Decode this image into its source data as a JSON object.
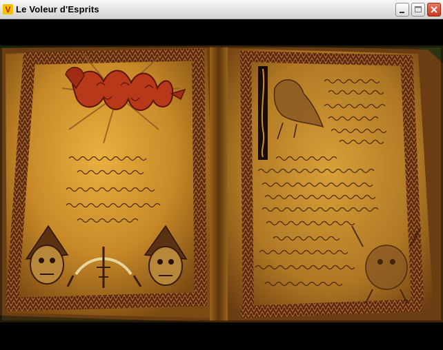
{
  "window": {
    "title": "Le Voleur d'Esprits",
    "app_icon_glyph": "V",
    "app_icon_color": "#f2c400",
    "app_icon_glyph_color": "#c62000"
  },
  "controls": {
    "minimize_icon": "minimize-icon",
    "maximize_icon": "maximize-icon",
    "close_icon": "close-icon",
    "close_color": "#d8462c"
  },
  "scene": {
    "description_icon": "open-spellbook",
    "parchment_color": "#c08a2a",
    "border_color": "#5a2a10"
  }
}
